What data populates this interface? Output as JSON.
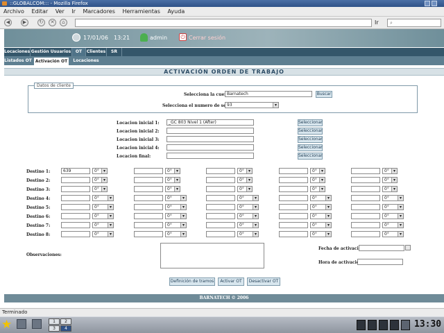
{
  "browser": {
    "title": "::GLOBALCOM::: - Mozilla Firefox",
    "menu": [
      "Archivo",
      "Editar",
      "Ver",
      "Ir",
      "Marcadores",
      "Herramientas",
      "Ayuda"
    ],
    "go_label": "Ir",
    "status": "Terminado"
  },
  "header": {
    "date": "17/01/06",
    "time": "13:21",
    "user": "admin",
    "logout": "Cerrar sesión"
  },
  "tabs": [
    "Locaciones",
    "Gestión Usuarios",
    "OT",
    "Clientes",
    "SR"
  ],
  "subtabs": [
    "Listados OT",
    "Activación OT",
    "Locaciones"
  ],
  "page_title": "ACTIVACIÓN ORDEN DE TRABAJO",
  "client": {
    "legend": "Datos de cliente",
    "account_label": "Selecciona la cuenta:",
    "account_value": "Barnatech",
    "search_button": "Buscar",
    "service_label": "Selecciona el numero de servicio:",
    "service_value": "93"
  },
  "locations": {
    "items": [
      {
        "label": "Locacion inicial 1:",
        "value": "_GC 803 Nivel 1 (After)"
      },
      {
        "label": "Locacion inicial 2:",
        "value": ""
      },
      {
        "label": "Locacion inicial 3:",
        "value": ""
      },
      {
        "label": "Locacion inicial 4:",
        "value": ""
      },
      {
        "label": "Locacion final:",
        "value": ""
      }
    ],
    "select_button": "Seleccionar"
  },
  "destinos": {
    "labels": [
      "Destino 1:",
      "Destino 2:",
      "Destino 3:",
      "Destino 4:",
      "Destino 5:",
      "Destino 6:",
      "Destino 7:",
      "Destino 8:"
    ],
    "first_value": "639",
    "degree": "0°"
  },
  "observaciones_label": "Observaciones:",
  "activation": {
    "date_label": "Fecha de activación:",
    "time_label": "Hora de activación:"
  },
  "buttons": {
    "tramos": "Definición de tramos",
    "activar": "Activar OT",
    "desactivar": "Desactivar OT"
  },
  "footer": "BARNATECH © 2006",
  "taskbar": {
    "clock": "13:30",
    "pages": [
      "1",
      "2",
      "3",
      "4"
    ]
  }
}
